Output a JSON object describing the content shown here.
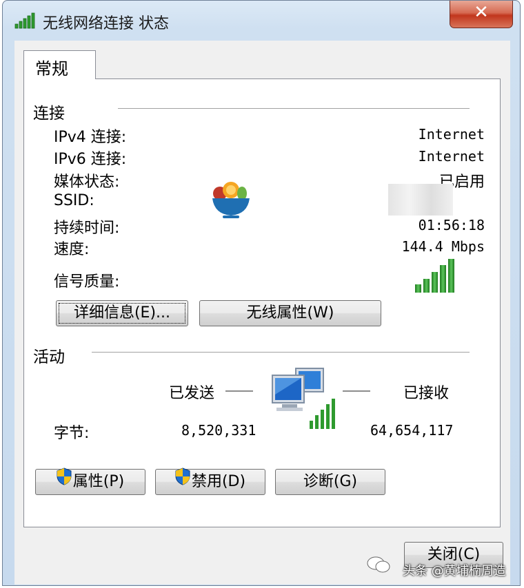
{
  "window": {
    "title": "无线网络连接 状态",
    "close_label": "✕"
  },
  "tab": {
    "label": "常规"
  },
  "connection": {
    "heading": "连接",
    "rows": [
      {
        "label": "IPv4 连接:",
        "value": "Internet"
      },
      {
        "label": "IPv6 连接:",
        "value": "Internet"
      },
      {
        "label": "媒体状态:",
        "value": "已启用"
      },
      {
        "label": "SSID:",
        "value": ""
      },
      {
        "label": "持续时间:",
        "value": "01:56:18"
      },
      {
        "label": "速度:",
        "value": "144.4 Mbps"
      }
    ],
    "signal_label": "信号质量:",
    "signal_bars": 5,
    "details_button": "详细信息(E)...",
    "wireless_props_button": "无线属性(W)"
  },
  "activity": {
    "heading": "活动",
    "sent_label": "已发送",
    "received_label": "已接收",
    "bytes_label": "字节:",
    "bytes_sent": "8,520,331",
    "bytes_received": "64,654,117"
  },
  "buttons": {
    "properties": "属性(P)",
    "disable": "禁用(D)",
    "diagnose": "诊断(G)",
    "close": "关闭(C)"
  },
  "watermark": {
    "text": "头条 @黄埔楠周造"
  },
  "colors": {
    "title_bar": "#cfe0f1",
    "close_red": "#c1361d",
    "signal_green": "#2e9a2e",
    "panel_bg": "#ffffff",
    "dialog_bg": "#f0f0f0"
  },
  "icons": [
    "signal-icon",
    "close-icon",
    "network-computers-icon",
    "uac-shield-icon",
    "wechat-icon"
  ]
}
